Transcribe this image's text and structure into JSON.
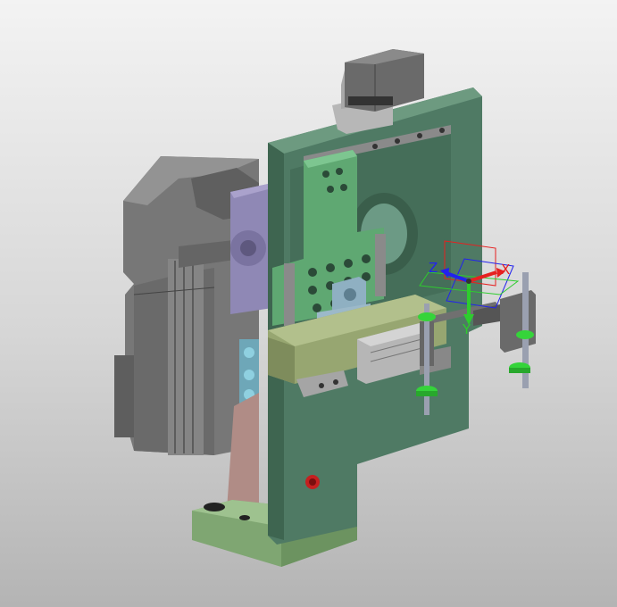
{
  "viewport": {
    "background_top": "#f3f3f3",
    "background_bottom": "#b4b4b4"
  },
  "model": {
    "plate_color": "#4f7a64",
    "base_color": "#7fa672",
    "bracket_color": "#5fa872",
    "motor_color": "#6e6e6e",
    "adapter_color": "#8f88b5",
    "slide_color": "#97a671",
    "ring_color": "#35d43a",
    "pink_guard_color": "#b08c86"
  },
  "triad": {
    "x_label": "X",
    "y_label": "Y",
    "z_label": "Z",
    "x_color": "#e62020",
    "y_color": "#2ecc2e",
    "z_color": "#2222ee"
  }
}
